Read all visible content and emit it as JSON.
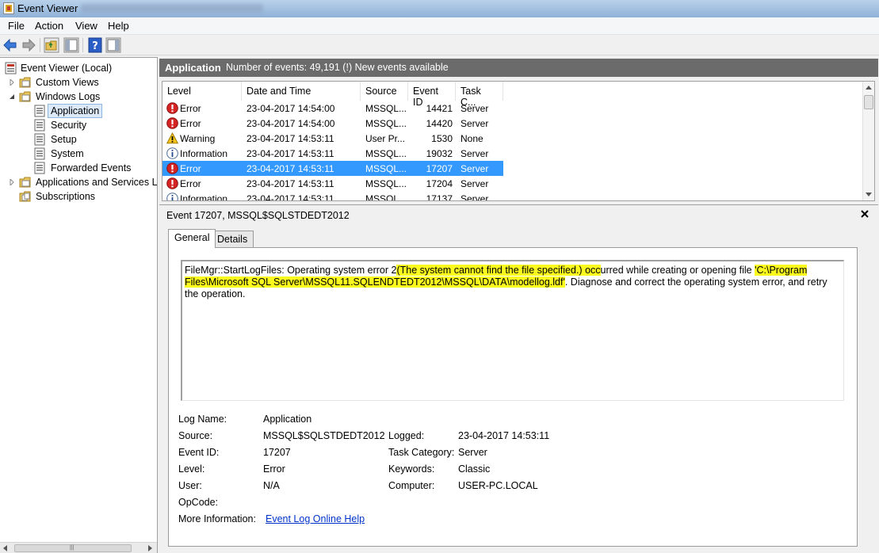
{
  "window": {
    "title": "Event Viewer"
  },
  "menu": [
    "File",
    "Action",
    "View",
    "Help"
  ],
  "toolbar": {
    "icons": [
      "back-arrow-icon",
      "forward-arrow-icon",
      "up-folder-icon",
      "show-hide-tree-icon",
      "help-icon",
      "show-hide-action-pane-icon"
    ]
  },
  "tree": [
    {
      "label": "Event Viewer (Local)",
      "icon": "event-viewer-icon",
      "expander": "none"
    },
    {
      "label": "Custom Views",
      "icon": "folder-icon",
      "expander": "collapsed"
    },
    {
      "label": "Windows Logs",
      "icon": "folder-icon",
      "expander": "expanded"
    },
    {
      "label": "Application",
      "icon": "log-icon",
      "expander": "none",
      "selected": true
    },
    {
      "label": "Security",
      "icon": "log-icon",
      "expander": "none"
    },
    {
      "label": "Setup",
      "icon": "log-icon",
      "expander": "none"
    },
    {
      "label": "System",
      "icon": "log-icon",
      "expander": "none"
    },
    {
      "label": "Forwarded Events",
      "icon": "log-icon",
      "expander": "none"
    },
    {
      "label": "Applications and Services Lo",
      "icon": "folder-icon",
      "expander": "collapsed"
    },
    {
      "label": "Subscriptions",
      "icon": "subscriptions-icon",
      "expander": "none"
    }
  ],
  "pane_header": {
    "title": "Application",
    "info": "Number of events: 49,191 (!) New events available"
  },
  "columns": [
    "Level",
    "Date and Time",
    "Source",
    "Event ID",
    "Task C..."
  ],
  "events": [
    {
      "level": "Error",
      "icon": "error",
      "datetime": "23-04-2017 14:54:00",
      "source": "MSSQL...",
      "id": "14421",
      "task": "Server"
    },
    {
      "level": "Error",
      "icon": "error",
      "datetime": "23-04-2017 14:54:00",
      "source": "MSSQL...",
      "id": "14420",
      "task": "Server"
    },
    {
      "level": "Warning",
      "icon": "warning",
      "datetime": "23-04-2017 14:53:11",
      "source": "User Pr...",
      "id": "1530",
      "task": "None"
    },
    {
      "level": "Information",
      "icon": "information",
      "datetime": "23-04-2017 14:53:11",
      "source": "MSSQL...",
      "id": "19032",
      "task": "Server"
    },
    {
      "level": "Error",
      "icon": "error",
      "datetime": "23-04-2017 14:53:11",
      "source": "MSSQL...",
      "id": "17207",
      "task": "Server",
      "selected": true
    },
    {
      "level": "Error",
      "icon": "error",
      "datetime": "23-04-2017 14:53:11",
      "source": "MSSQL...",
      "id": "17204",
      "task": "Server"
    },
    {
      "level": "Information",
      "icon": "information",
      "datetime": "23-04-2017 14:53:11",
      "source": "MSSQL...",
      "id": "17137",
      "task": "Server"
    }
  ],
  "detail": {
    "title": "Event 17207, MSSQL$SQLSTDEDT2012",
    "tabs": [
      "General",
      "Details"
    ],
    "description": {
      "part1": "FileMgr::StartLogFiles: Operating system error 2",
      "highlight1": "(The system cannot find the file specified.) occ",
      "part2": "urred while creating or opening file ",
      "highlight2": "'C:\\Program Files\\Microsoft SQL Server\\MSSQL11.SQLENDTEDT2012\\MSSQL\\DATA\\modellog.ldf'",
      "part3": ". Diagnose and correct the operating system error, and retry the operation."
    },
    "props": {
      "log_name_label": "Log Name:",
      "log_name": "Application",
      "source_label": "Source:",
      "source": "MSSQL$SQLSTDEDT2012",
      "logged_label": "Logged:",
      "logged": "23-04-2017 14:53:11",
      "event_id_label": "Event ID:",
      "event_id": "17207",
      "task_category_label": "Task Category:",
      "task_category": "Server",
      "level_label": "Level:",
      "level": "Error",
      "keywords_label": "Keywords:",
      "keywords": "Classic",
      "user_label": "User:",
      "user": "N/A",
      "computer_label": "Computer:",
      "computer": "USER-PC.LOCAL",
      "opcode_label": "OpCode:",
      "opcode": "",
      "more_info_label": "More Information:",
      "more_info_link": "Event Log Online Help"
    }
  },
  "colors": {
    "selection": "#3399ff",
    "highlight": "#fafa1e",
    "header_bg": "#6b6b6b",
    "link": "#0033cc"
  }
}
